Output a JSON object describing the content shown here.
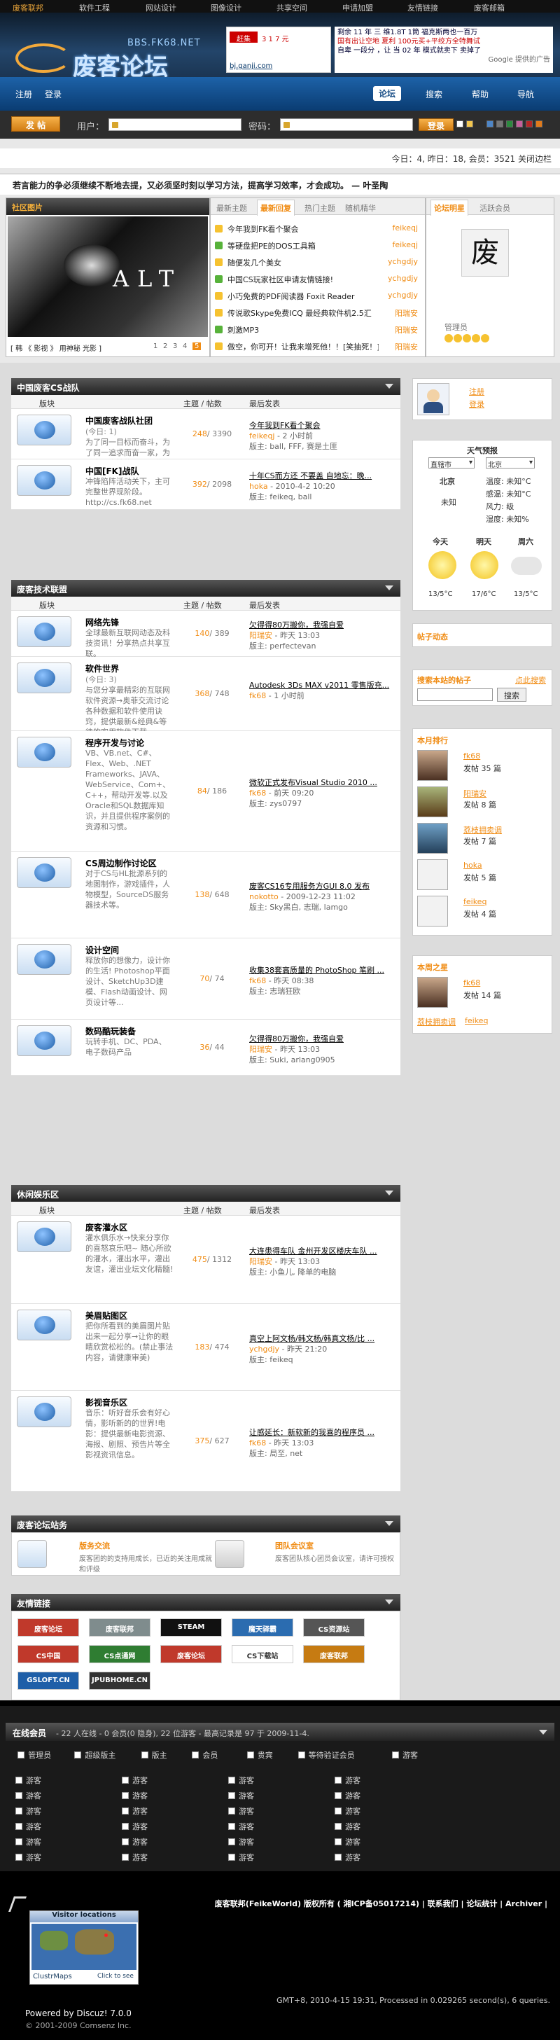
{
  "topbar": {
    "items": [
      "废客联邦",
      "软件工程",
      "网站设计",
      "图像设计",
      "共享空间",
      "申请加盟",
      "友情链接",
      "废客邮箱"
    ]
  },
  "header": {
    "logo_url": "BBS.FK68.NET",
    "logo_text": "废客论坛",
    "ad_left_site": "bj.ganji.com",
    "ad_left_price": "3 1 7 元",
    "ad_right_lines": [
      "剩余 11 年  三 维1.8T 1筒  福克斯两也一百万",
      "国有出让空地 夏利 100元买+平绞方全特舞试",
      "自卑  一段分 ，让 当 02 年 模式就卖下 卖掉了"
    ],
    "ad_right_foot": "Google 提供的广告"
  },
  "nav": {
    "left": [
      "注册",
      "登录"
    ],
    "right": [
      "论坛",
      "搜索",
      "帮助",
      "导航"
    ],
    "current": "论坛"
  },
  "login": {
    "post_label": "发 帖",
    "user_label": "用户：",
    "pass_label": "密码：",
    "login_btn": "登录"
  },
  "status": {
    "text": "今日：4, 昨日：18, 会员：3521 关闭边栏"
  },
  "bulletin": {
    "text": "若言能力的争必须继续不断地去提，又必须坚时刻以学习方法，提高学习效率，才会成功。 — 叶圣陶"
  },
  "featured": {
    "tab_pic": "社区图片",
    "tabs": [
      "最新主题",
      "最新回复",
      "热门主题",
      "随机精华"
    ],
    "active_tab": "最新回复",
    "pic_caption": "[ 韩 《 影视 》 用神秘 光影 ]",
    "pages": [
      "1",
      "2",
      "3",
      "4",
      "5"
    ],
    "threads": [
      {
        "title": "今年我到FK看个聚会",
        "author": "feikeqj"
      },
      {
        "title": "等硬盘把PE的DOS工具箱",
        "author": "feikeqj"
      },
      {
        "title": "随便发几个美女",
        "author": "ychgdjy"
      },
      {
        "title": "中国CS玩家社区申请友情链接!",
        "author": "ychgdjy"
      },
      {
        "title": "小巧免费的PDF阅读器 Foxit Reader",
        "author": "ychgdjy"
      },
      {
        "title": "传说歌Skype免费ICQ 最经典软件机2.5汇",
        "author": "阳瑞安"
      },
      {
        "title": "刺激MP3",
        "author": "阳瑞安"
      },
      {
        "title": "做空，你可开！让我来增死他！！[笑抽死！]",
        "author": "阳瑞安"
      }
    ],
    "star_tabs": [
      "论坛明星",
      "活跃会员"
    ],
    "star_name": "管理员"
  },
  "sections": [
    {
      "title": "中国废客CS战队",
      "forums": [
        {
          "name": "中国废客战队社团",
          "today": "(今日: 1)",
          "desc": "为了同一目标而奋斗，为了同一追求而奋一家，为了电子竞技的明天而共斗奋争。",
          "count": "248",
          "posts": "/ 3390",
          "last_title": "今年我到FK看个聚会",
          "last_user": "feikeqj",
          "last_time": "- 2 小时前",
          "last_mod": "版主: ball, FFF, 赛是土匪"
        },
        {
          "name": "中国[FK]战队",
          "today": "",
          "desc": "冲锋陷阵活动关下，主可完整世界现阶段。http://cs.fk68.net",
          "count": "392",
          "posts": "/ 2098",
          "last_title": "十年CS而方还 不要盖 自地忘：晚...",
          "last_user": "hoka",
          "last_time": "- 2010-4-2 10:20",
          "last_mod": "版主: feikeq, ball"
        }
      ]
    },
    {
      "title": "废客技术联盟",
      "forums": [
        {
          "name": "网络先锋",
          "today": "",
          "desc": "全球最新互联网动态及科技资讯！分享热点共享互联。",
          "count": "140",
          "posts": "/ 389",
          "last_title": "欠得得80万搬你，我强自爱",
          "last_user": "阳瑞安",
          "last_time": "- 昨天 13:03",
          "last_mod": "版主: perfectevan"
        },
        {
          "name": "软件世界",
          "today": "(今日: 3)",
          "desc": "与您分享最精彩的互联网软件资源→奥菲交流讨论各种数据和软件使用诀窍，提供最新&经典&等待的实用软件下载。",
          "count": "368",
          "posts": "/ 748",
          "last_title": "Autodesk 3Ds MAX v2011 零售版充...",
          "last_user": "fk68",
          "last_time": "- 1 小时前",
          "last_mod": ""
        },
        {
          "name": "程序开发与讨论",
          "today": "",
          "desc": "VB、VB.net、C#、Flex、Web、.NET Frameworks、JAVA、WebService、Com+、C++，帮动开发等.以及Oracle和SQL数据库知识，并且提供程序案例的资源和习惯。",
          "count": "84",
          "posts": "/ 186",
          "last_title": "微软正式发布Visual Studio 2010 ...",
          "last_user": "fk68",
          "last_time": "- 前天 09:20",
          "last_mod": "版主: zys0797"
        },
        {
          "name": "CS周边制作讨论区",
          "today": "",
          "desc": "对于CS与HL批源系列的地图制作，游戏插件，人物模型，SourceDS服务器技术等。",
          "count": "138",
          "posts": "/ 648",
          "last_title": "废客CS16专用服务方GUI 8.0 发布",
          "last_user": "nokotto",
          "last_time": "- 2009-12-23 11:02",
          "last_mod": "版主: Sky黑白, 志瑞, lamgo"
        },
        {
          "name": "设计空间",
          "today": "",
          "desc": "释放你的想像力，设计你的生活! Photoshop平面设计、SketchUp3D建模、Flash动画设计、网页设计等...",
          "count": "70",
          "posts": "/ 74",
          "last_title": "收集38套高质量的 PhotoShop 笔刷 ...",
          "last_user": "fk68",
          "last_time": "- 昨天 08:38",
          "last_mod": "版主: 志瑞狂欧"
        },
        {
          "name": "数码酷玩装备",
          "today": "",
          "desc": "玩转手机、DC、PDA、电子数码产品",
          "count": "36",
          "posts": "/ 44",
          "last_title": "欠得得80万搬你，我强自爱",
          "last_user": "阳瑞安",
          "last_time": "- 昨天 13:03",
          "last_mod": "版主: Suki, arlang0905"
        }
      ]
    },
    {
      "title": "休闲娱乐区",
      "forums": [
        {
          "name": "废客灌水区",
          "today": "",
          "desc": "灌水俱乐水→快来分享你的喜怒哀乐吧~ 随心所欲的灌水，灌出水平，灌出友谊，灌出业坛文化精髓!",
          "count": "475",
          "posts": "/ 1312",
          "last_title": "大连患得车队 金州开发区楼庆车队 ...",
          "last_user": "阳瑞安",
          "last_time": "- 昨天 13:03",
          "last_mod": "版主: 小鱼儿, 降单的电脑"
        },
        {
          "name": "美眉贴图区",
          "today": "",
          "desc": "把你所看到的美眉图片贴出来一起分享→让你的眼睛欣赏松松的。(禁止事法内容，请健康审美)",
          "count": "183",
          "posts": "/ 474",
          "last_title": "真空上阿文杨/韩文杨/韩真文杨/比 ...",
          "last_user": "ychgdjy",
          "last_time": "- 昨天 21:20",
          "last_mod": "版主: feikeq"
        },
        {
          "name": "影视音乐区",
          "today": "",
          "desc": "音乐：听好音乐会有好心情，影听新的的世界!电影：提供最新电影资源、海报、剧照、预告片等全影视资讯信息。",
          "count": "375",
          "posts": "/ 627",
          "last_title": "让感延长：新软新的我喜的程序员 ...",
          "last_user": "fk68",
          "last_time": "- 昨天 13:03",
          "last_mod": "版主: 局至, net"
        }
      ]
    }
  ],
  "col_headers": {
    "forum": "版块",
    "count": "主题 / 帖数",
    "last": "最后发表"
  },
  "station": {
    "title": "废客论坛站务",
    "items": [
      {
        "name": "版务交流",
        "desc": "废客团的的支持用成长，已近的关注用成就和评级"
      },
      {
        "name": "团队会议室",
        "desc": "废客团队核心团员会议室，请许可授权"
      }
    ]
  },
  "links": {
    "title": "友情链接",
    "items": [
      "废客论坛",
      "废客联邦",
      "STEAM",
      "魔天驿霸",
      "CS资源站",
      "CS中国",
      "CS点通网",
      "废客论坛",
      "CS下载站",
      "废客联邦",
      "GSLOFT.CN",
      "JPUBHOME.CN"
    ]
  },
  "online": {
    "title": "在线会员",
    "summary": "- 22 人在线 - 0 会员(0 隐身), 22 位游客 - 最高记录是 97 于 2009-11-4.",
    "legend": [
      "管理员",
      "超级版主",
      "版主",
      "会员",
      "贵宾",
      "等待验证会员",
      "游客"
    ],
    "guest_label": "游客",
    "rows": 6,
    "cols": 4
  },
  "sidebar": {
    "user_links": [
      "注册",
      "登录"
    ],
    "weather": {
      "title": "天气预报",
      "province": "直辖市",
      "city": "北京",
      "place": "北京",
      "state": "未知",
      "temp": "温度: 未知°C",
      "feel": "感温: 未知°C",
      "wind": "风力: 级",
      "humid": "湿度: 未知%",
      "days": [
        "今天",
        "明天",
        "周六"
      ],
      "temps": [
        "13/5°C",
        "17/6°C",
        "13/5°C"
      ]
    },
    "forum_news_title": "帖子动态",
    "search_title": "搜索本站的帖子",
    "search_hint": "点此搜索",
    "search_btn": "搜索",
    "rank_title": "本月排行",
    "rank": [
      {
        "name": "fk68",
        "posts": "发帖 35 篇"
      },
      {
        "name": "阳瑞安",
        "posts": "发帖 8 篇"
      },
      {
        "name": "荔枝拥卖调",
        "posts": "发帖 7 篇"
      },
      {
        "name": "hoka",
        "posts": "发帖 5 篇"
      },
      {
        "name": "feikeq",
        "posts": "发帖 4 篇"
      }
    ],
    "week_title": "本周之星",
    "week": {
      "name": "fk68",
      "posts": "发帖 14 篇",
      "extra": [
        "荔枝拥卖调",
        "feikeq"
      ]
    }
  },
  "footer": {
    "copy": "废客联邦(FeikeWorld) 版权所有 ( 湘ICP备05017214) | 联系我们 | 论坛统计 | Archiver |",
    "map_title": "Visitor locations",
    "map_foot": "ClustrMaps",
    "map_click": "Click to see",
    "gmt": "GMT+8, 2010-4-15 19:31, Processed in 0.029265 second(s), 6 queries.",
    "powered": "Powered by Discuz! 7.0.0",
    "company": "© 2001-2009 Comsenz Inc."
  }
}
